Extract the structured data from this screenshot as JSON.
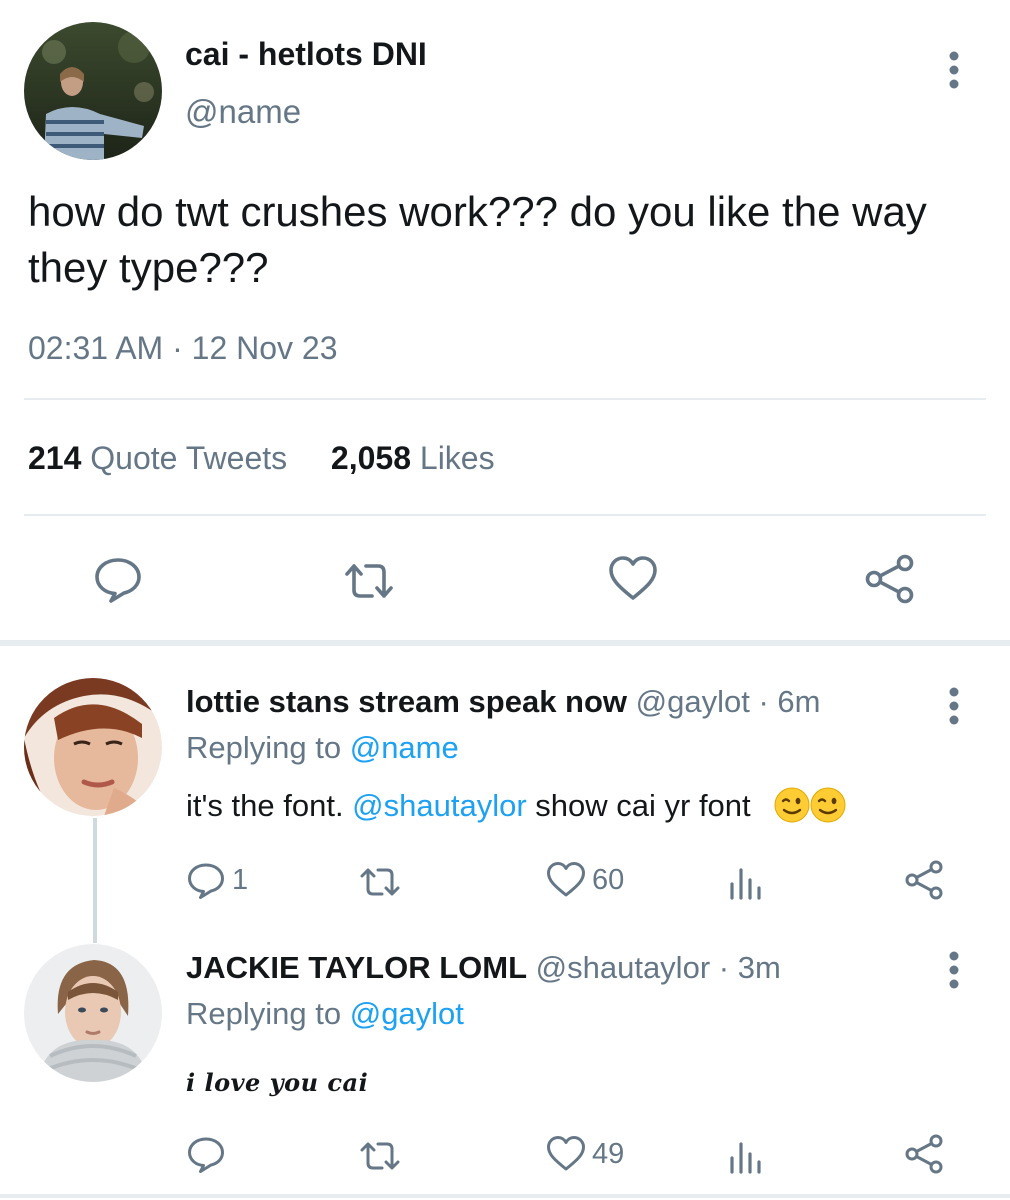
{
  "main_tweet": {
    "display_name": "cai - hetlots DNI",
    "handle": "@name",
    "text": "how do twt crushes work??? do you like the way they type???",
    "timestamp": "02:31 AM · 12 Nov 23",
    "quote_tweets_count": "214",
    "quote_tweets_label": "Quote Tweets",
    "likes_count": "2,058",
    "likes_label": "Likes"
  },
  "replies": [
    {
      "display_name": "lottie stans stream speak now",
      "handle": "@gaylot",
      "age": "· 6m",
      "replying_prefix": "Replying to ",
      "replying_to": "@name",
      "text_before": "it's the font. ",
      "mention": "@shautaylor",
      "text_after": " show cai yr font",
      "reply_count": "1",
      "like_count": "60"
    },
    {
      "display_name": "JACKIE TAYLOR LOML",
      "handle": "@shautaylor",
      "age": "· 3m",
      "replying_prefix": "Replying to ",
      "replying_to": "@gaylot",
      "text": "i love you cai",
      "like_count": "49"
    }
  ],
  "colors": {
    "accent": "#1da1f2",
    "secondary_text": "#657786",
    "divider": "#e6ecf0"
  }
}
